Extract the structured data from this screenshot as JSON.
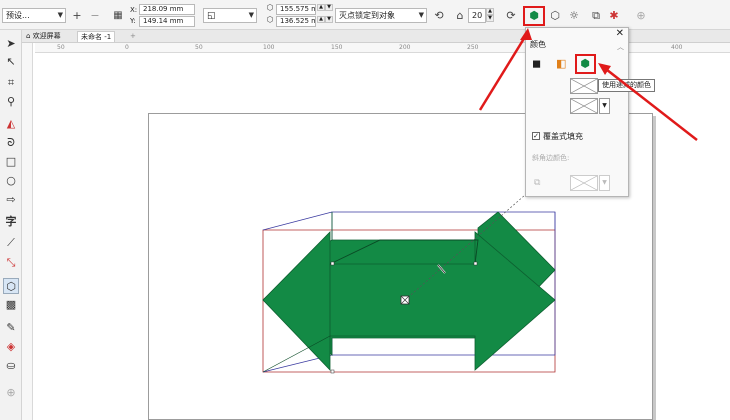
{
  "propbar": {
    "preset": "预设...",
    "x_value": "218.09 mm",
    "y_value": "149.14 mm",
    "x_label": "X:",
    "y_label": "Y:",
    "vp_x": "155.575 mr",
    "vp_y": "136.525 mr",
    "vanish_point_mode": "灭点锁定到对象",
    "depth_value": "20"
  },
  "tabs": [
    {
      "label": "欢迎屏幕"
    },
    {
      "label": "未命名 -1"
    }
  ],
  "ruler": {
    "ticks": [
      "50",
      "0",
      "50",
      "100",
      "150",
      "200",
      "250",
      "300",
      "350",
      "400"
    ]
  },
  "docker": {
    "section_title": "颜色",
    "tooltip": "使用递减的颜色",
    "overprint_label": "覆盖式填充",
    "overprint_checked": true,
    "bevel_label": "斜角边颜色:"
  },
  "colors": {
    "extrude_green": "#138a45",
    "highlight_red": "#e01a1a",
    "bbox_red": "#b03030",
    "bbox_blue": "#3a3aa0"
  }
}
